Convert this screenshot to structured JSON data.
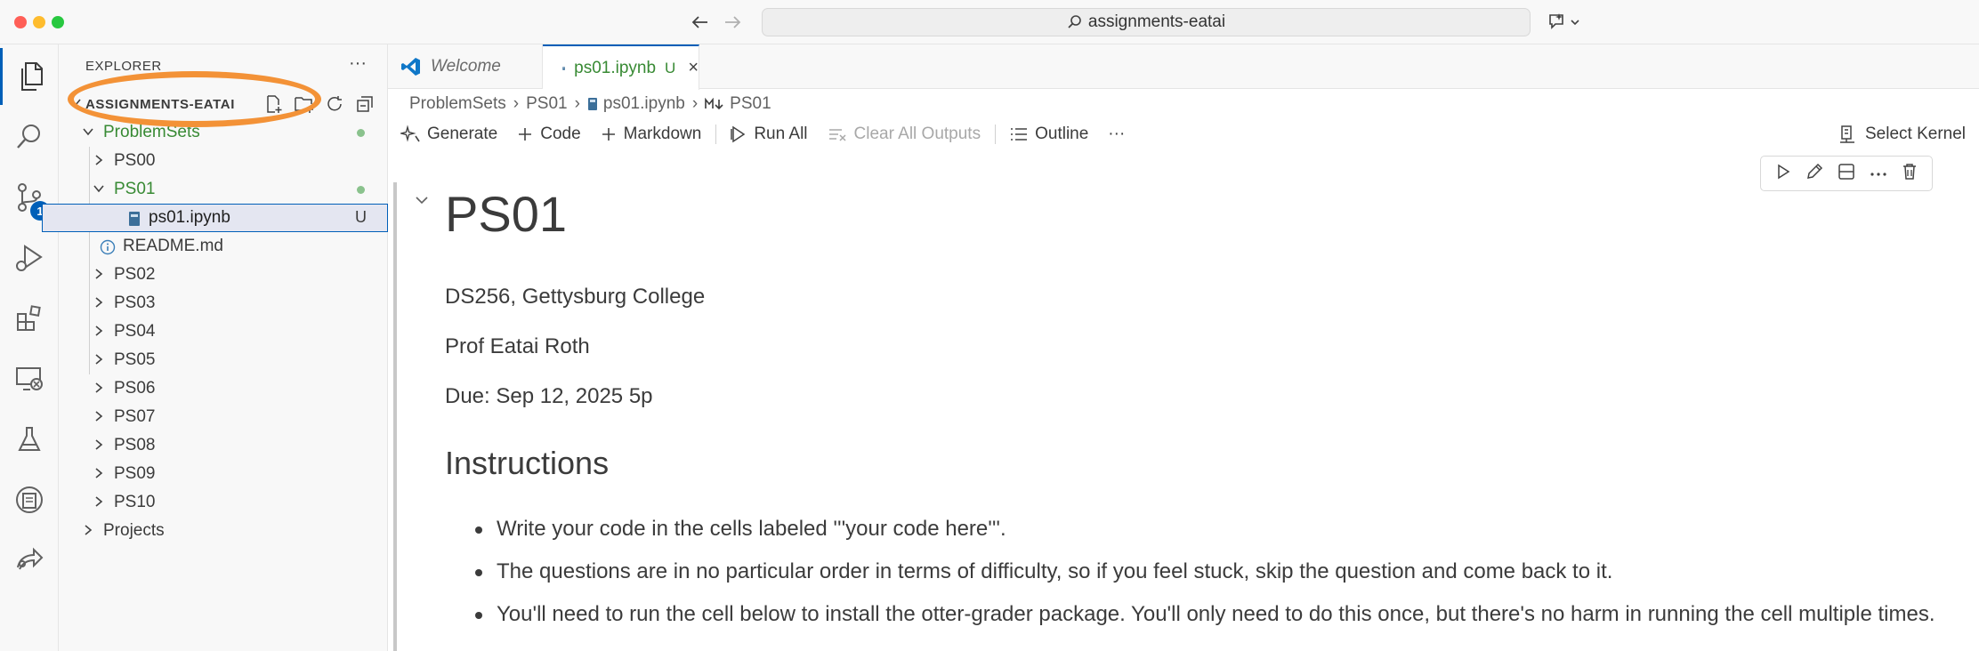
{
  "window": {
    "search_text": "assignments-eatai"
  },
  "activity_bar": {
    "scm_badge": "1"
  },
  "explorer": {
    "title": "EXPLORER",
    "more": "···",
    "workspace_name": "ASSIGNMENTS-EATAI",
    "tree": {
      "problemsets": "ProblemSets",
      "ps00": "PS00",
      "ps01": "PS01",
      "ps01_nb": "ps01.ipynb",
      "ps01_nb_status": "U",
      "readme": "README.md",
      "ps02": "PS02",
      "ps03": "PS03",
      "ps04": "PS04",
      "ps05": "PS05",
      "ps06": "PS06",
      "ps07": "PS07",
      "ps08": "PS08",
      "ps09": "PS09",
      "ps10": "PS10",
      "projects": "Projects"
    }
  },
  "tabs": {
    "welcome": "Welcome",
    "notebook": "ps01.ipynb",
    "notebook_status": "U",
    "close": "×"
  },
  "breadcrumb": {
    "c1": "ProblemSets",
    "c2": "PS01",
    "c3": "ps01.ipynb",
    "c4": "PS01"
  },
  "toolbar": {
    "generate": "Generate",
    "code": "Code",
    "markdown": "Markdown",
    "run_all": "Run All",
    "clear_outputs": "Clear All Outputs",
    "outline": "Outline",
    "more": "···",
    "select_kernel": "Select Kernel"
  },
  "notebook": {
    "heading": "PS01",
    "line1": "DS256, Gettysburg College",
    "line2": "Prof Eatai Roth",
    "line3": "Due: Sep 12, 2025 5p",
    "instructions_heading": "Instructions",
    "bullets": [
      "Write your code in the cells labeled '''your code here'''.",
      "The questions are in no particular order in terms of difficulty, so if you feel stuck, skip the question and come back to it.",
      "You'll need to run the cell below to install the otter-grader package. You'll only need to do this once, but there's no harm in running the cell multiple times."
    ]
  },
  "colors": {
    "accent": "#005fb8",
    "git_untracked": "#388a34",
    "annotation": "#f39237"
  }
}
